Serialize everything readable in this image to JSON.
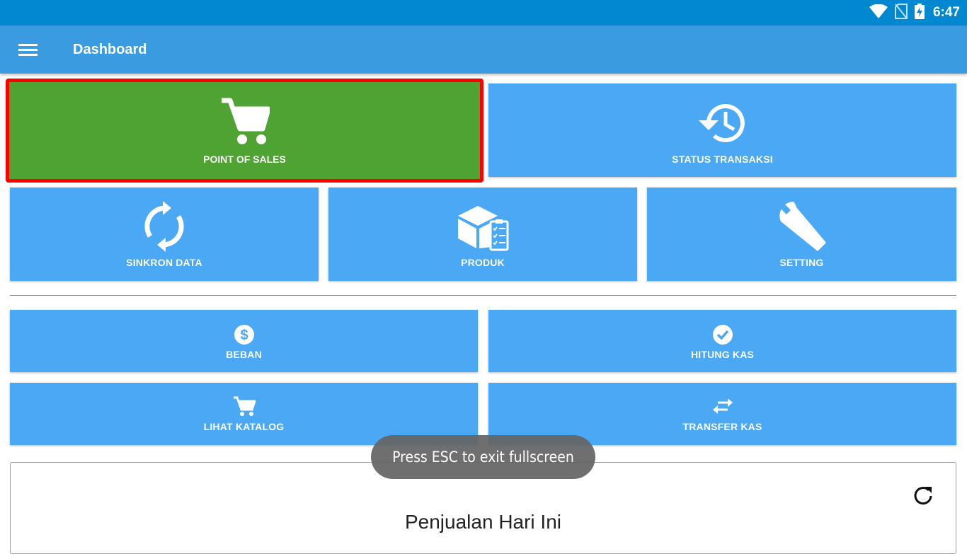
{
  "status_bar": {
    "time": "6:47",
    "icons": [
      "wifi-icon",
      "no-sim-icon",
      "battery-charging-icon"
    ]
  },
  "app_bar": {
    "menu_icon": "hamburger-menu-icon",
    "title": "Dashboard"
  },
  "tiles_top": [
    {
      "label": "POINT OF SALES",
      "icon": "shopping-cart-icon",
      "color": "#4ea332",
      "highlighted": true,
      "highlight_color": "#ff0000"
    },
    {
      "label": "STATUS TRANSAKSI",
      "icon": "history-icon",
      "color": "#4aa8f5"
    }
  ],
  "tiles_middle": [
    {
      "label": "SINKRON DATA",
      "icon": "sync-icon"
    },
    {
      "label": "PRODUK",
      "icon": "product-box-checklist-icon"
    },
    {
      "label": "SETTING",
      "icon": "wrench-icon"
    }
  ],
  "tiles_bottom": [
    {
      "label": "BEBAN",
      "icon": "dollar-circle-icon"
    },
    {
      "label": "HITUNG KAS",
      "icon": "check-circle-icon"
    },
    {
      "label": "LIHAT KATALOG",
      "icon": "cart-icon"
    },
    {
      "label": "TRANSFER KAS",
      "icon": "swap-arrows-icon"
    }
  ],
  "sales_card": {
    "title": "Penjualan Hari Ini",
    "refresh_icon": "refresh-icon"
  },
  "toast": {
    "text": "Press ESC to exit fullscreen"
  },
  "colors": {
    "status_bar": "#0288d1",
    "app_bar": "#3b9be0",
    "tile": "#4aa8f5",
    "pos_tile": "#4ea332",
    "highlight_border": "#ff0000"
  }
}
